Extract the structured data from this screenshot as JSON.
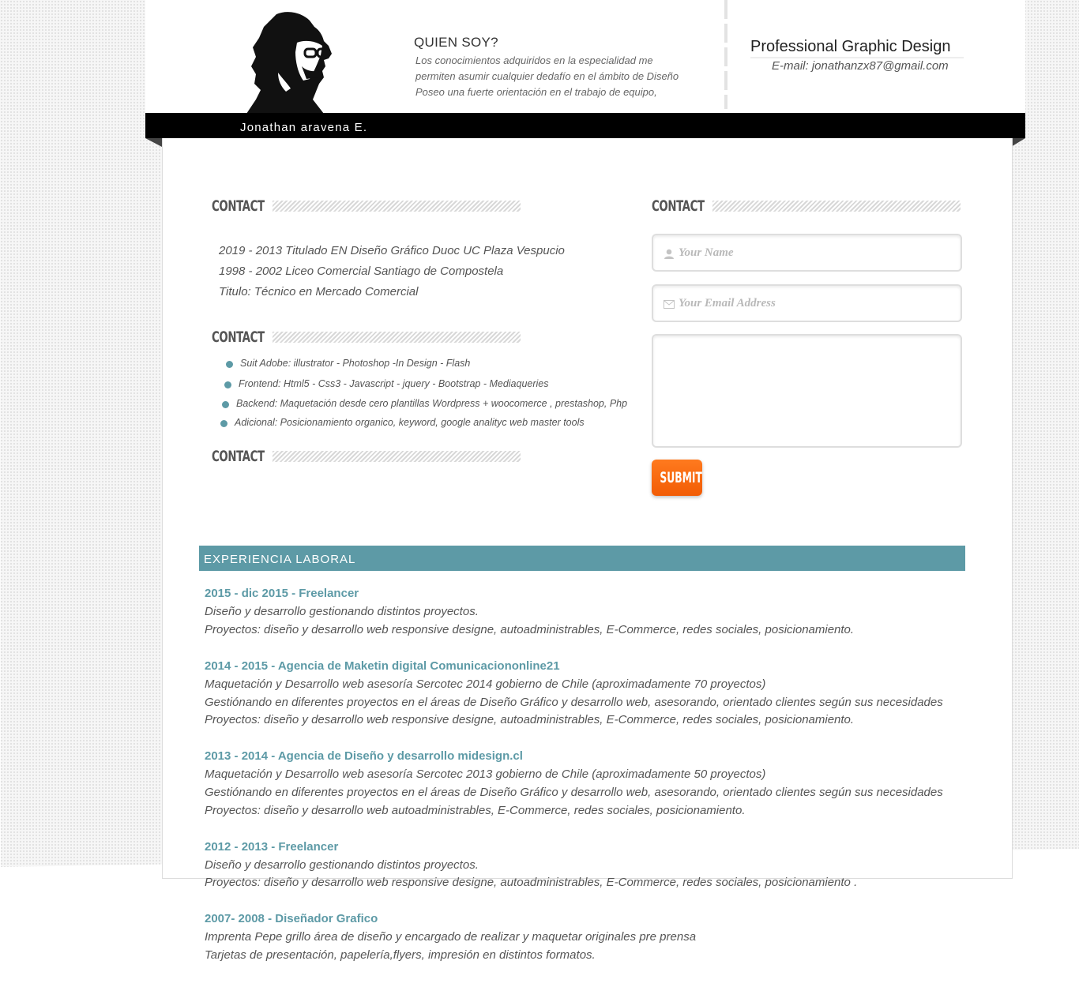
{
  "header": {
    "about_title": "QUIEN SOY?",
    "about_lines": [
      "Los conocimientos adquiridos en la especialidad me",
      "permiten asumir cualquier dedafío en el ámbito de Diseño",
      "Poseo una fuerte orientación en el trabajo de equipo,"
    ],
    "role": "Professional Graphic Design",
    "email": "E-mail: jonathanzx87@gmail.com",
    "name": "Jonathan aravena E."
  },
  "sections": {
    "education_title": "CONTACT",
    "skills_title": "CONTACT",
    "extra_title": "CONTACT",
    "form_title": "CONTACT"
  },
  "education": [
    "2019 - 2013 Titulado  EN Diseño Gráfico Duoc UC Plaza Vespucio",
    "1998 - 2002 Liceo Comercial Santiago de Compostela",
    "Titulo: Técnico en Mercado Comercial"
  ],
  "skills": [
    "Suit Adobe: illustrator - Photoshop -In Design - Flash",
    "Frontend: Html5 - Css3 - Javascript - jquery - Bootstrap -  Mediaqueries",
    "Backend: Maquetación desde cero plantillas Wordpress + woocomerce , prestashop, Php",
    "Adicional: Posicionamiento organico, keyword, google analityc web master tools"
  ],
  "form": {
    "name_placeholder": "Your Name",
    "email_placeholder": "Your Email Address",
    "message_value": "",
    "submit_label": "SUBMIT",
    "user_icon": "user-icon",
    "mail_icon": "envelope-icon"
  },
  "experience": {
    "title": "EXPERIENCIA LABORAL",
    "jobs": [
      {
        "title": "2015 - dic 2015 - Freelancer",
        "lines": [
          "Diseño y desarrollo gestionando distintos proyectos.",
          "Proyectos: diseño y desarrollo web  responsive designe, autoadministrables, E-Commerce, redes sociales, posicionamiento."
        ]
      },
      {
        "title": "2014 - 2015 - Agencia de Maketin digital Comunicaciononline21",
        "lines": [
          "Maquetación y Desarrollo web asesoría Sercotec 2014 gobierno de Chile (aproximadamente 70 proyectos)",
          "Gestiónando en diferentes proyectos en el áreas de Diseño Gráfico y desarrollo web, asesorando, orientado clientes según sus necesidades",
          "Proyectos: diseño y desarrollo web  responsive designe, autoadministrables, E-Commerce, redes sociales, posicionamiento."
        ]
      },
      {
        "title": "2013 - 2014  - Agencia de Diseño y  desarrollo midesign.cl",
        "lines": [
          "Maquetación y Desarrollo web asesoría Sercotec 2013 gobierno de Chile (aproximadamente 50 proyectos)",
          "Gestiónando en diferentes proyectos en el áreas de Diseño Gráfico y desarrollo web, asesorando, orientado clientes según sus necesidades",
          "Proyectos: diseño y desarrollo web  autoadministrables, E-Commerce, redes sociales, posicionamiento."
        ]
      },
      {
        "title": "2012 - 2013 - Freelancer",
        "lines": [
          "Diseño y desarrollo gestionando distintos proyectos.",
          "Proyectos: diseño y desarrollo web  responsive designe, autoadministrables, E-Commerce, redes sociales, posicionamiento ."
        ]
      },
      {
        "title": "2007- 2008 - Diseñador Grafico",
        "lines": [
          "Imprenta Pepe grillo área de diseño y encargado de realizar y maquetar originales pre prensa",
          "Tarjetas de presentación, papelería,flyers, impresión en distintos formatos."
        ]
      }
    ]
  },
  "colors": {
    "accent": "#5d9aa6",
    "submit": "#f26a0f",
    "namebar": "#000000"
  }
}
